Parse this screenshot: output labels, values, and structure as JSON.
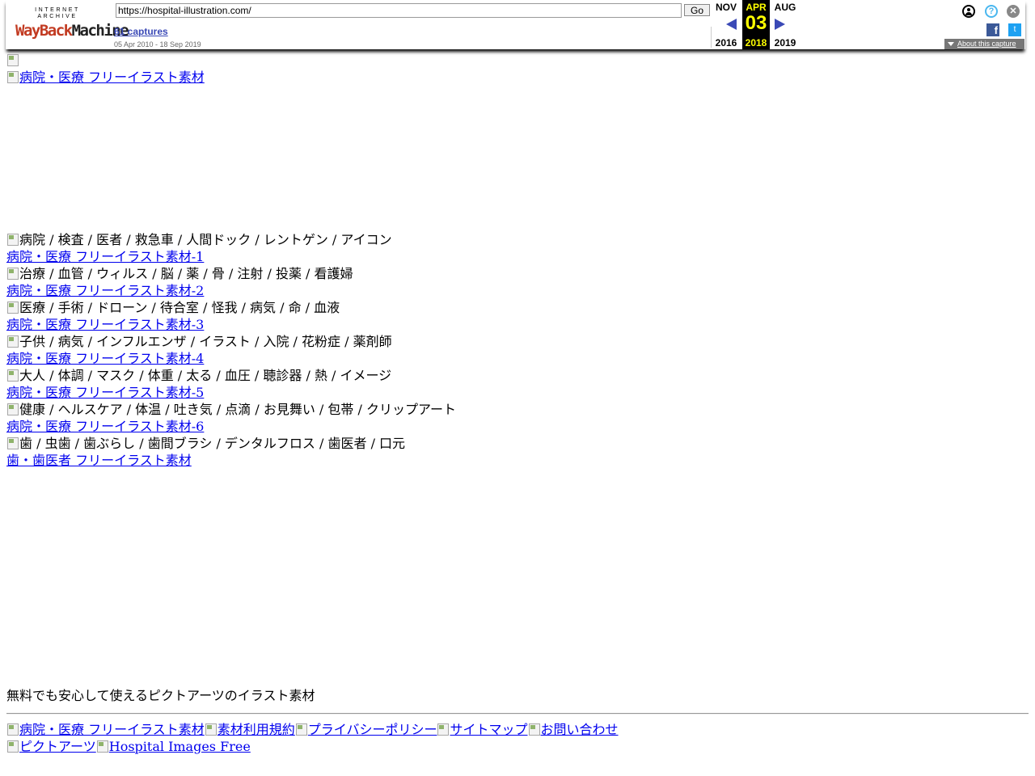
{
  "wayback": {
    "logo_top": "INTERNET ARCHIVE",
    "logo_wayback": "WayBack",
    "logo_machine": "Machine",
    "url": "https://hospital-illustration.com/",
    "go_label": "Go",
    "captures_label": "61 captures",
    "date_range": "05 Apr 2010 - 18 Sep 2019",
    "prev_month": "NOV",
    "cur_month": "APR",
    "next_month": "AUG",
    "cur_day": "03",
    "prev_year": "2016",
    "cur_year": "2018",
    "next_year": "2019",
    "help_glyph": "?",
    "close_glyph": "✕",
    "facebook_glyph": "f",
    "twitter_glyph": "t",
    "about_label": "About this capture"
  },
  "page": {
    "header_logo_alt": "病院・医療 フリーイラスト素材",
    "sections": [
      {
        "tags": "病院 / 検査 / 医者 / 救急車 / 人間ドック / レントゲン / アイコン",
        "link": "病院・医療 フリーイラスト素材-1"
      },
      {
        "tags": "治療 / 血管 / ウィルス / 脳 / 薬 / 骨 / 注射 / 投薬 / 看護婦",
        "link": "病院・医療 フリーイラスト素材-2"
      },
      {
        "tags": "医療 / 手術 / ドローン / 待合室 / 怪我 / 病気 / 命 / 血液",
        "link": "病院・医療 フリーイラスト素材-3"
      },
      {
        "tags": "子供 / 病気 / インフルエンザ / イラスト / 入院 / 花粉症 / 薬剤師",
        "link": "病院・医療 フリーイラスト素材-4"
      },
      {
        "tags": "大人 / 体調 / マスク / 体重 / 太る / 血圧 / 聴診器 / 熱 / イメージ",
        "link": "病院・医療 フリーイラスト素材-5"
      },
      {
        "tags": "健康 / ヘルスケア / 体温 / 吐き気 / 点滴 / お見舞い / 包帯 / クリップアート",
        "link": "病院・医療 フリーイラスト素材-6"
      },
      {
        "tags": "歯 / 虫歯 / 歯ぶらし / 歯間ブラシ / デンタルフロス / 歯医者 / 口元",
        "link": "歯・歯医者 フリーイラスト素材"
      }
    ],
    "tagline": "無料でも安心して使えるピクトアーツのイラスト素材",
    "footer_row1": [
      "病院・医療 フリーイラスト素材",
      "素材利用規約",
      "プライバシーポリシー",
      "サイトマップ",
      "お問い合わせ"
    ],
    "footer_row2": [
      "ピクトアーツ",
      "Hospital Images Free"
    ]
  }
}
